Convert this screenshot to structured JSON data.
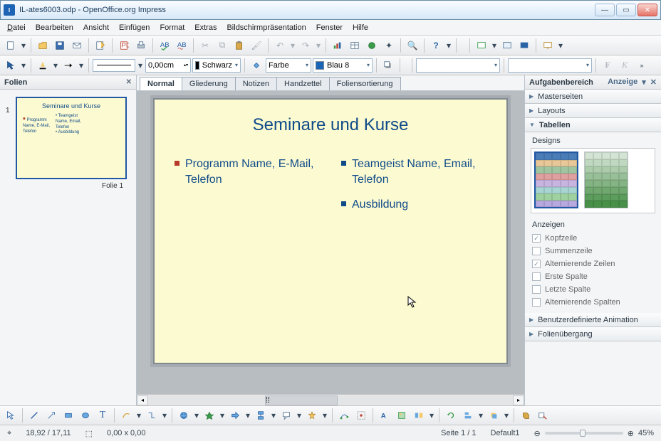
{
  "title": "IL-ates6003.odp - OpenOffice.org Impress",
  "menu": [
    "Datei",
    "Bearbeiten",
    "Ansicht",
    "Einfügen",
    "Format",
    "Extras",
    "Bildschirmpräsentation",
    "Fenster",
    "Hilfe"
  ],
  "toolbar3": {
    "linewidth": "0,00cm",
    "colorname": "Schwarz",
    "fillmode": "Farbe",
    "fillcolor": "Blau 8"
  },
  "leftpanel": {
    "title": "Folien",
    "slide_label": "Folie 1",
    "slide_num": "1"
  },
  "tabs": [
    "Normal",
    "Gliederung",
    "Notizen",
    "Handzettel",
    "Foliensortierung"
  ],
  "slide": {
    "title": "Seminare und Kurse",
    "col1": [
      {
        "text": "Programm Name, E-Mail, Telefon",
        "red": true
      }
    ],
    "col2": [
      {
        "text": "Teamgeist Name, Email, Telefon"
      },
      {
        "text": "Ausbildung"
      }
    ]
  },
  "rightpanel": {
    "title": "Aufgabenbereich",
    "view": "Anzeige",
    "acc": [
      "Masterseiten",
      "Layouts",
      "Tabellen",
      "Benutzerdefinierte Animation",
      "Folienübergang"
    ],
    "designs_label": "Designs",
    "anzeigen_label": "Anzeigen",
    "checks": [
      {
        "label": "Kopfzeile",
        "checked": true
      },
      {
        "label": "Summenzeile",
        "checked": false
      },
      {
        "label": "Alternierende Zeilen",
        "checked": true
      },
      {
        "label": "Erste Spalte",
        "checked": false
      },
      {
        "label": "Letzte Spalte",
        "checked": false
      },
      {
        "label": "Alternierende Spalten",
        "checked": false
      }
    ]
  },
  "status": {
    "pos": "18,92 / 17,11",
    "size": "0,00 x 0,00",
    "page": "Seite 1 / 1",
    "master": "Default1",
    "zoom": "45%"
  },
  "colors": {
    "blau8": "#1964b4",
    "schwarz": "#000000"
  }
}
